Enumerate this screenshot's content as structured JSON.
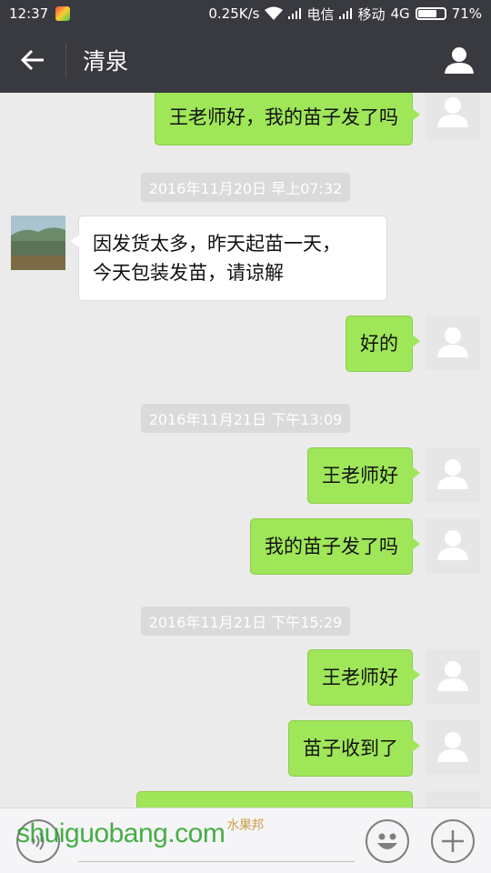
{
  "status_bar": {
    "time": "12:37",
    "speed": "0.25K/s",
    "carrier1": "电信",
    "carrier2": "移动",
    "network": "4G",
    "battery": "71%",
    "battery_level": 0.71
  },
  "header": {
    "title": "清泉",
    "back_icon": "arrow-left-icon",
    "profile_icon": "person-icon"
  },
  "messages": [
    {
      "type": "me",
      "text": "王老师好，我的苗子发了吗"
    },
    {
      "type": "timestamp",
      "text": "2016年11月20日 早上07:32"
    },
    {
      "type": "them",
      "line1": "因发货太多，昨天起苗一天，",
      "line2": "今天包装发苗，请谅解"
    },
    {
      "type": "me",
      "text": "好的"
    },
    {
      "type": "timestamp",
      "text": "2016年11月21日 下午13:09"
    },
    {
      "type": "me",
      "text": "王老师好"
    },
    {
      "type": "me",
      "text": "我的苗子发了吗"
    },
    {
      "type": "timestamp",
      "text": "2016年11月21日 下午15:29"
    },
    {
      "type": "me",
      "text": "王老师好"
    },
    {
      "type": "me",
      "text": "苗子收到了"
    }
  ],
  "input_bar": {
    "voice_icon": "voice-icon",
    "emoji_icon": "smiley-icon",
    "plus_icon": "plus-icon"
  },
  "watermark": {
    "text": "shuiguobang.com",
    "cn": "水果邦"
  },
  "colors": {
    "header_bg": "#393a3f",
    "bubble_me": "#9fe658",
    "bubble_them": "#ffffff",
    "chat_bg": "#ebebeb"
  }
}
